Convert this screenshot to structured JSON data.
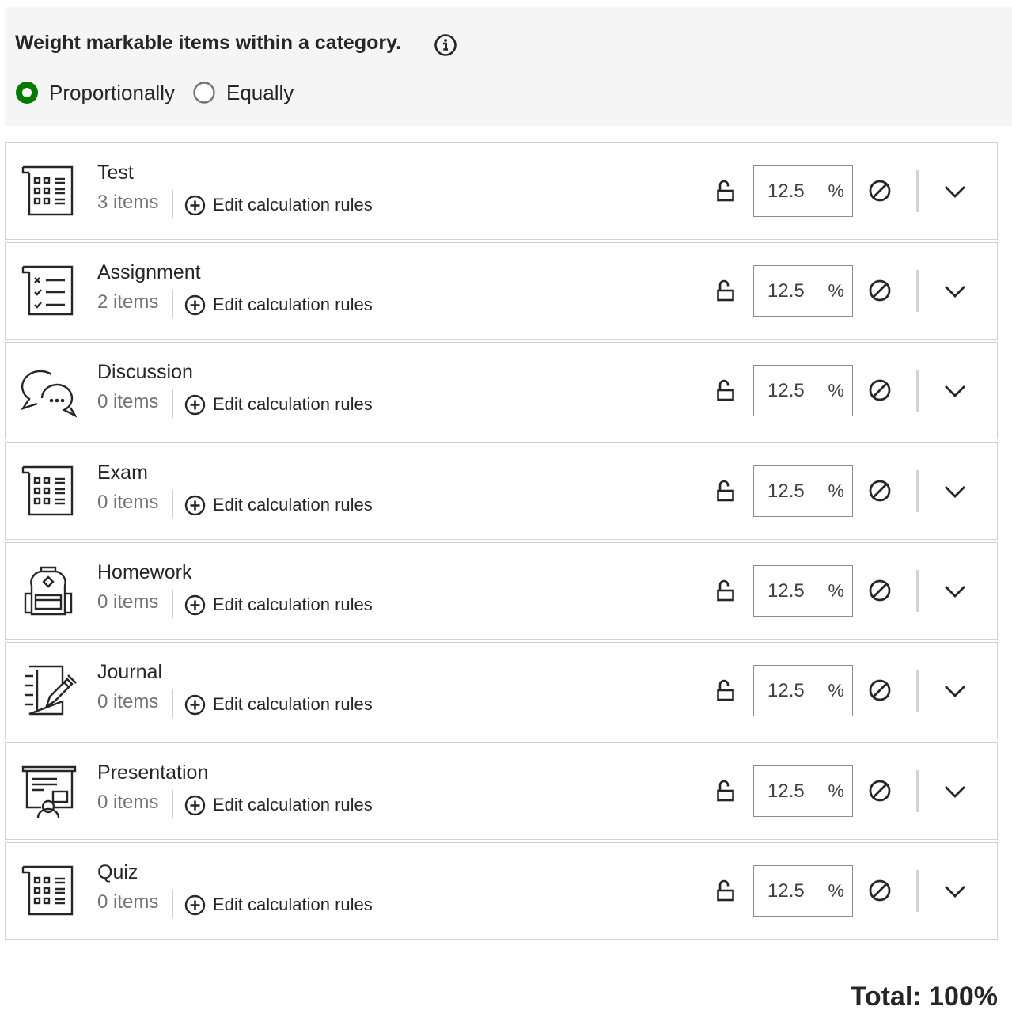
{
  "weighting": {
    "title": "Weight markable items within a category.",
    "info_icon": "info-icon",
    "options": [
      {
        "label": "Proportionally",
        "selected": true
      },
      {
        "label": "Equally",
        "selected": false
      }
    ],
    "accent_color": "#037a00"
  },
  "categories": [
    {
      "name": "Test",
      "count": "3 items",
      "icon": "calculator-document-icon",
      "edit_label": "Edit calculation rules",
      "weight": "12.5",
      "unit": "%"
    },
    {
      "name": "Assignment",
      "count": "2 items",
      "icon": "checklist-icon",
      "edit_label": "Edit calculation rules",
      "weight": "12.5",
      "unit": "%"
    },
    {
      "name": "Discussion",
      "count": "0 items",
      "icon": "speech-bubbles-icon",
      "edit_label": "Edit calculation rules",
      "weight": "12.5",
      "unit": "%"
    },
    {
      "name": "Exam",
      "count": "0 items",
      "icon": "calculator-document-icon",
      "edit_label": "Edit calculation rules",
      "weight": "12.5",
      "unit": "%"
    },
    {
      "name": "Homework",
      "count": "0 items",
      "icon": "backpack-icon",
      "edit_label": "Edit calculation rules",
      "weight": "12.5",
      "unit": "%"
    },
    {
      "name": "Journal",
      "count": "0 items",
      "icon": "notebook-pencil-icon",
      "edit_label": "Edit calculation rules",
      "weight": "12.5",
      "unit": "%"
    },
    {
      "name": "Presentation",
      "count": "0 items",
      "icon": "presentation-board-icon",
      "edit_label": "Edit calculation rules",
      "weight": "12.5",
      "unit": "%"
    },
    {
      "name": "Quiz",
      "count": "0 items",
      "icon": "calculator-document-icon",
      "edit_label": "Edit calculation rules",
      "weight": "12.5",
      "unit": "%"
    }
  ],
  "row_icons": {
    "lock": "unlocked-padlock-icon",
    "exclude": "exclude-icon",
    "expand": "chevron-down-icon",
    "edit": "plus-circle-icon"
  },
  "total": "Total: 100%"
}
